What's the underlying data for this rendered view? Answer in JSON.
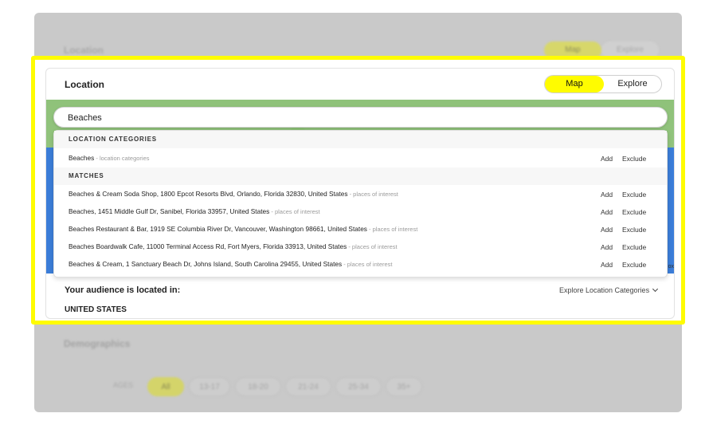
{
  "background": {
    "location_title": "Location",
    "map_label": "Map",
    "explore_label": "Explore",
    "demographics_title": "Demographics",
    "ages_label": "AGES",
    "age_options": [
      "All",
      "13-17",
      "18-20",
      "21-24",
      "25-34",
      "35+"
    ]
  },
  "location": {
    "title": "Location",
    "tabs": {
      "map": "Map",
      "explore": "Explore"
    },
    "search_value": "Beaches",
    "categories_header": "LOCATION CATEGORIES",
    "matches_header": "MATCHES",
    "categories": [
      {
        "name": "Beaches",
        "type": " - location categories",
        "add": "Add",
        "exclude": "Exclude"
      }
    ],
    "matches": [
      {
        "name": "Beaches & Cream Soda Shop, 1800 Epcot Resorts Blvd, Orlando, Florida 32830, United States",
        "type": " - places of interest",
        "add": "Add",
        "exclude": "Exclude"
      },
      {
        "name": "Beaches, 1451 Middle Gulf Dr, Sanibel, Florida 33957, United States",
        "type": " - places of interest",
        "add": "Add",
        "exclude": "Exclude"
      },
      {
        "name": "Beaches Restaurant & Bar, 1919 SE Columbia River Dr, Vancouver, Washington 98661, United States",
        "type": " - places of interest",
        "add": "Add",
        "exclude": "Exclude"
      },
      {
        "name": "Beaches Boardwalk Cafe, 11000 Terminal Access Rd, Fort Myers, Florida 33913, United States",
        "type": " - places of interest",
        "add": "Add",
        "exclude": "Exclude"
      },
      {
        "name": "Beaches & Cream, 1 Sanctuary Beach Dr, Johns Island, South Carolina 29455, United States",
        "type": " - places of interest",
        "add": "Add",
        "exclude": "Exclude"
      }
    ],
    "audience_label": "Your audience is located in:",
    "explore_categories": "Explore Location Categories",
    "country": "UNITED STATES"
  },
  "colors": {
    "accent": "#fffc00",
    "water": "#3b7dd8"
  }
}
